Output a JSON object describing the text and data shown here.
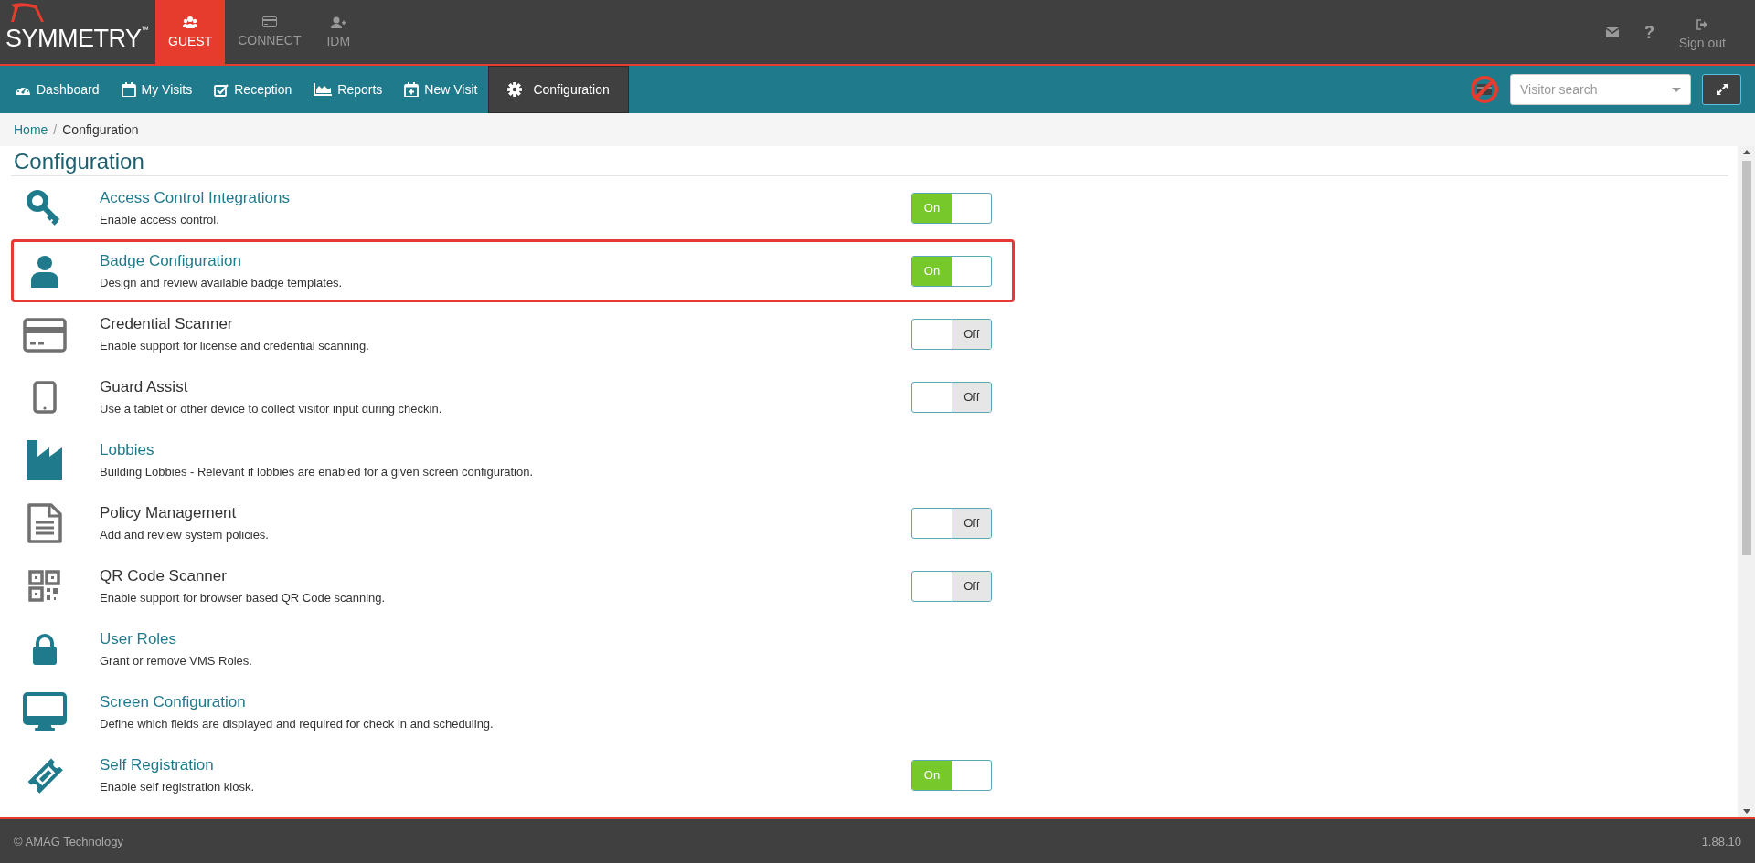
{
  "top_bar": {
    "logo": {
      "name": "SYMMETRY",
      "trademark": "™"
    },
    "apps": [
      {
        "label": "GUEST",
        "selected": true
      },
      {
        "label": "CONNECT",
        "selected": false
      },
      {
        "label": "IDM",
        "selected": false
      }
    ],
    "sign_out": "Sign out"
  },
  "nav": {
    "tabs": [
      {
        "label": "Dashboard",
        "selected": false
      },
      {
        "label": "My Visits",
        "selected": false
      },
      {
        "label": "Reception",
        "selected": false
      },
      {
        "label": "Reports",
        "selected": false
      },
      {
        "label": "New Visit",
        "selected": false
      },
      {
        "label": "Configuration",
        "selected": true
      }
    ],
    "search": {
      "placeholder": "Visitor search"
    }
  },
  "breadcrumb": {
    "separator": "/",
    "items": [
      {
        "label": "Home",
        "current": false
      },
      {
        "label": "Configuration",
        "current": true
      }
    ]
  },
  "page_title": "Configuration",
  "items": [
    {
      "title": "Access Control Integrations",
      "description": "Enable access control.",
      "kind": "toggle",
      "on": true,
      "toggle_label": "On",
      "highlighted": false
    },
    {
      "title": "Badge Configuration",
      "description": "Design and review available badge templates.",
      "kind": "toggle",
      "on": true,
      "toggle_label": "On",
      "highlighted": true
    },
    {
      "title": "Credential Scanner",
      "description": "Enable support for license and credential scanning.",
      "kind": "toggle",
      "on": false,
      "toggle_label": "Off",
      "highlighted": false
    },
    {
      "title": "Guard Assist",
      "description": "Use a tablet or other device to collect visitor input during checkin.",
      "kind": "toggle",
      "on": false,
      "toggle_label": "Off",
      "highlighted": false
    },
    {
      "title": "Lobbies",
      "description": "Building Lobbies - Relevant if lobbies are enabled for a given screen configuration.",
      "kind": "link",
      "highlighted": false
    },
    {
      "title": "Policy Management",
      "description": "Add and review system policies.",
      "kind": "toggle",
      "on": false,
      "toggle_label": "Off",
      "highlighted": false
    },
    {
      "title": "QR Code Scanner",
      "description": "Enable support for browser based QR Code scanning.",
      "kind": "toggle",
      "on": false,
      "toggle_label": "Off",
      "highlighted": false
    },
    {
      "title": "User Roles",
      "description": "Grant or remove VMS Roles.",
      "kind": "link",
      "highlighted": false
    },
    {
      "title": "Screen Configuration",
      "description": "Define which fields are displayed and required for check in and scheduling.",
      "kind": "link",
      "highlighted": false
    },
    {
      "title": "Self Registration",
      "description": "Enable self registration kiosk.",
      "kind": "toggle",
      "on": true,
      "toggle_label": "On",
      "highlighted": false
    }
  ],
  "footer": {
    "copyright": "© AMAG Technology",
    "version": "1.88.10"
  }
}
